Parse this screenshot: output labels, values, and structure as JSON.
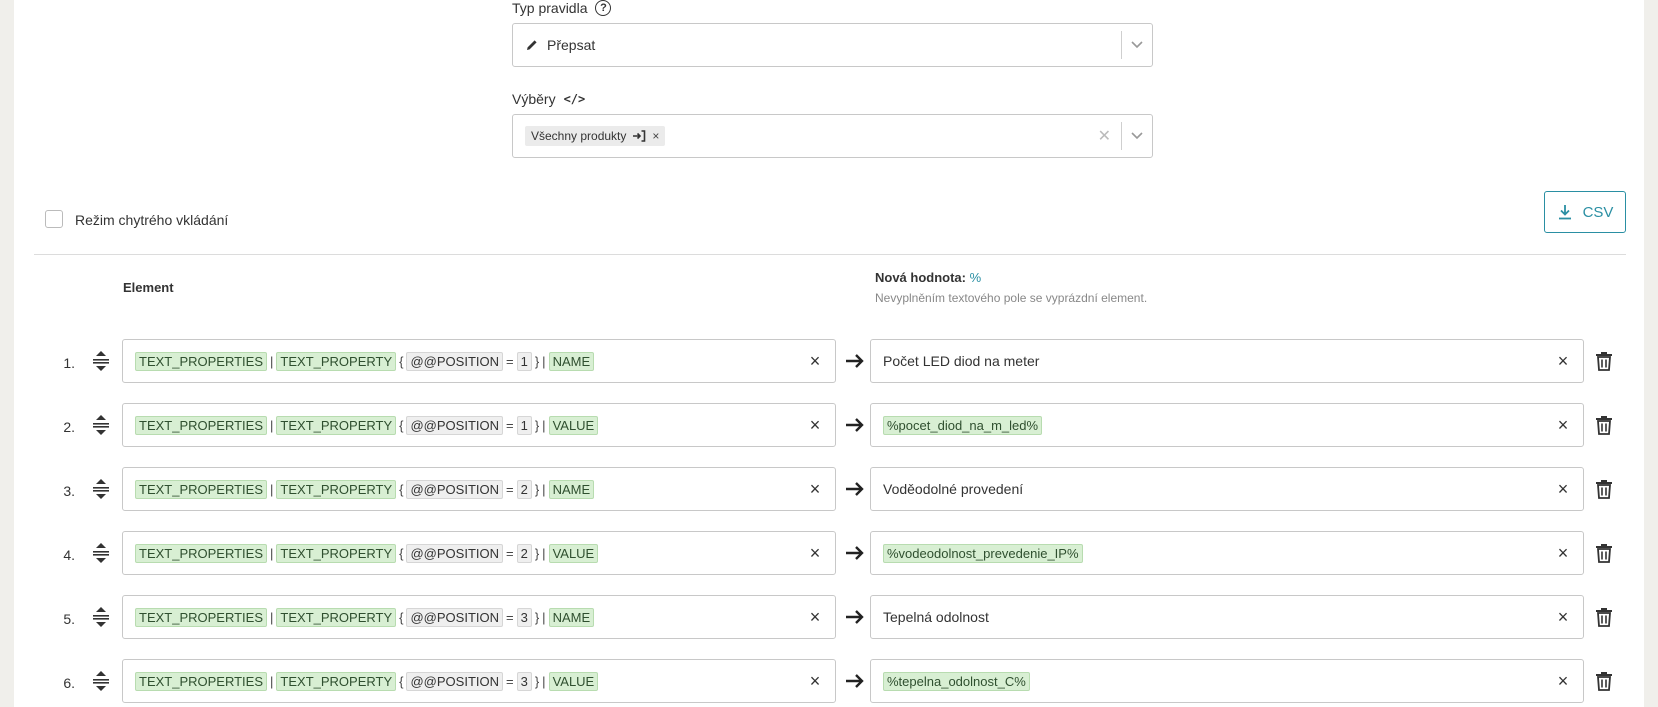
{
  "rule_type": {
    "label": "Typ pravidla",
    "help_icon": "?",
    "value": "Přepsat"
  },
  "selections": {
    "label": "Výběry",
    "code_icon": "</>",
    "chip": "Všechny produkty",
    "chip_remove": "×"
  },
  "smart_insert": {
    "label": "Režim chytrého vkládání"
  },
  "csv_button": {
    "label": "CSV"
  },
  "columns": {
    "element": "Element",
    "new_value": "Nová hodnota:",
    "new_value_symbol": "%",
    "hint": "Nevyplněním textového pole se vyprázdní element."
  },
  "rows": [
    {
      "num": "1.",
      "t1": "TEXT_PROPERTIES",
      "t2": "TEXT_PROPERTY",
      "t3": "@@POSITION",
      "pos": "1",
      "t4": "NAME",
      "value": "Počet LED diod na meter",
      "value_is_token": false
    },
    {
      "num": "2.",
      "t1": "TEXT_PROPERTIES",
      "t2": "TEXT_PROPERTY",
      "t3": "@@POSITION",
      "pos": "1",
      "t4": "VALUE",
      "value": "%pocet_diod_na_m_led%",
      "value_is_token": true
    },
    {
      "num": "3.",
      "t1": "TEXT_PROPERTIES",
      "t2": "TEXT_PROPERTY",
      "t3": "@@POSITION",
      "pos": "2",
      "t4": "NAME",
      "value": "Voděodolné provedení",
      "value_is_token": false
    },
    {
      "num": "4.",
      "t1": "TEXT_PROPERTIES",
      "t2": "TEXT_PROPERTY",
      "t3": "@@POSITION",
      "pos": "2",
      "t4": "VALUE",
      "value": "%vodeodolnost_prevedenie_IP%",
      "value_is_token": true
    },
    {
      "num": "5.",
      "t1": "TEXT_PROPERTIES",
      "t2": "TEXT_PROPERTY",
      "t3": "@@POSITION",
      "pos": "3",
      "t4": "NAME",
      "value": "Tepelná odolnost",
      "value_is_token": false
    },
    {
      "num": "6.",
      "t1": "TEXT_PROPERTIES",
      "t2": "TEXT_PROPERTY",
      "t3": "@@POSITION",
      "pos": "3",
      "t4": "VALUE",
      "value": "%tepelna_odolnost_C%",
      "value_is_token": true
    }
  ],
  "colors": {
    "accent": "#2a8fa3",
    "token_bg": "#d8efd3"
  }
}
